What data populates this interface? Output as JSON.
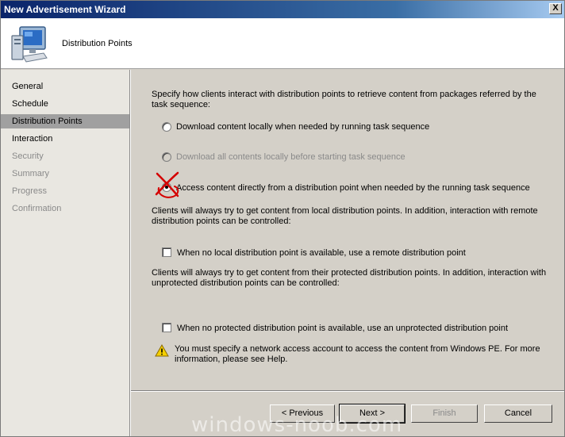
{
  "window": {
    "title": "New Advertisement Wizard",
    "close_label": "X"
  },
  "header": {
    "heading": "Distribution Points",
    "icon": "computer-icon"
  },
  "sidebar": {
    "items": [
      {
        "label": "General",
        "state": "normal"
      },
      {
        "label": "Schedule",
        "state": "normal"
      },
      {
        "label": "Distribution Points",
        "state": "active"
      },
      {
        "label": "Interaction",
        "state": "normal"
      },
      {
        "label": "Security",
        "state": "disabled"
      },
      {
        "label": "Summary",
        "state": "disabled"
      },
      {
        "label": "Progress",
        "state": "disabled"
      },
      {
        "label": "Confirmation",
        "state": "disabled"
      }
    ]
  },
  "main": {
    "intro": "Specify how clients interact with distribution points to retrieve content from packages referred by the task sequence:",
    "options": [
      {
        "label": "Download content locally when needed by running task sequence",
        "checked": false,
        "disabled": false
      },
      {
        "label": "Download all contents locally before starting task sequence",
        "checked": false,
        "disabled": true
      },
      {
        "label": "Access content directly from a distribution point when needed by the running task sequence",
        "checked": true,
        "disabled": false
      }
    ],
    "remote_info": "Clients will always try to get content from local distribution points. In addition, interaction with remote distribution points can be controlled:",
    "remote_checkbox": {
      "label": "When no local distribution point is available, use a remote distribution point",
      "checked": false
    },
    "protected_info": "Clients will always try to get content from their protected distribution points. In addition, interaction with unprotected distribution points can be controlled:",
    "unprotected_checkbox": {
      "label": "When no protected distribution point is available, use an unprotected distribution point",
      "checked": false
    },
    "warning": {
      "icon": "warning-icon",
      "text": "You must specify a network access account to access the content from Windows PE.  For more information, please see Help."
    }
  },
  "footer": {
    "previous_label": "< Previous",
    "next_label": "Next >",
    "finish_label": "Finish",
    "cancel_label": "Cancel"
  },
  "watermark": "windows-noob.com",
  "colors": {
    "title_bar": "#0a246a",
    "active_item": "#a0a0a0",
    "annotation": "#d40000"
  }
}
